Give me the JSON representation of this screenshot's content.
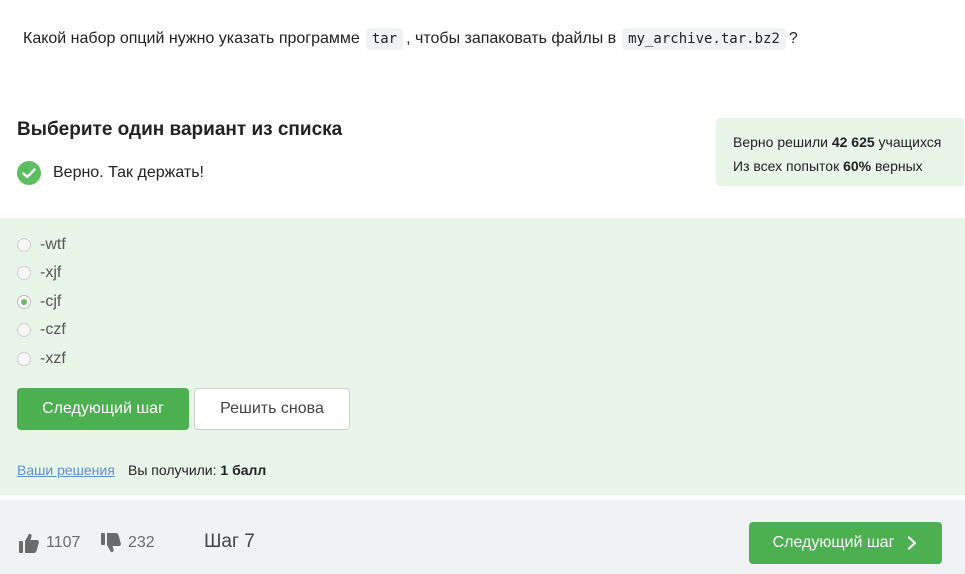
{
  "question": {
    "text_before": "Какой набор опций нужно указать программе",
    "code_program": "tar",
    "text_middle": ", чтобы запаковать файлы в",
    "code_file": "my_archive.tar.bz2",
    "text_after": "?"
  },
  "heading": "Выберите один вариант из списка",
  "verdict": {
    "text": "Верно. Так держать!",
    "icon": "check-icon",
    "color": "#5cbf5f"
  },
  "stats": {
    "line1_prefix": "Верно решили",
    "line1_value": "42 625",
    "line1_suffix": "учащихся",
    "line2_prefix": "Из всех попыток",
    "line2_value": "60%",
    "line2_suffix": "верных"
  },
  "options": [
    {
      "label": "-wtf",
      "selected": false
    },
    {
      "label": "-xjf",
      "selected": false
    },
    {
      "label": "-cjf",
      "selected": true
    },
    {
      "label": "-czf",
      "selected": false
    },
    {
      "label": "-xzf",
      "selected": false
    }
  ],
  "buttons": {
    "next_step": "Следующий шаг",
    "retry": "Решить снова"
  },
  "solutions_link": "Ваши решения",
  "score": {
    "prefix": "Вы получили:",
    "value": "1 балл"
  },
  "footer": {
    "likes": "1107",
    "dislikes": "232",
    "step": "Шаг 7",
    "next_step": "Следующий шаг",
    "like_icon": "thumbs-up-icon",
    "dislike_icon": "thumbs-down-icon",
    "next_icon": "chevron-right-icon"
  },
  "colors": {
    "accent": "#4caf50",
    "panel_bg": "#e8f5e9",
    "link": "#5e8fd1"
  }
}
